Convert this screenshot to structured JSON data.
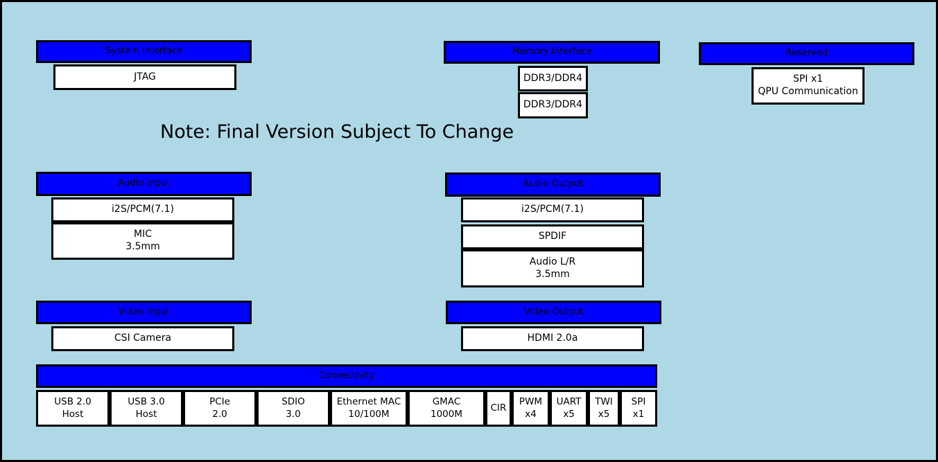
{
  "diagram": {
    "note": "Note: Final Version Subject To Change",
    "background_color": "#aed8e6",
    "header_color": "#0000ff",
    "cell_color": "#ffffff",
    "border_color": "#000000"
  },
  "groups": {
    "system_interface": {
      "title": "System Interface",
      "items": [
        {
          "line1": "JTAG",
          "line2": ""
        }
      ]
    },
    "memory_interface": {
      "title": "Memory Interface",
      "items": [
        {
          "line1": "DDR3/DDR4",
          "line2": ""
        },
        {
          "line1": "DDR3/DDR4",
          "line2": ""
        }
      ]
    },
    "reserved": {
      "title": "Reserved",
      "items": [
        {
          "line1": "SPI x1",
          "line2": "QPU Communication"
        }
      ]
    },
    "audio_input": {
      "title": "Audio Input",
      "items": [
        {
          "line1": "i2S/PCM(7.1)",
          "line2": ""
        },
        {
          "line1": "MIC",
          "line2": "3.5mm"
        }
      ]
    },
    "audio_output": {
      "title": "Audio Output",
      "items": [
        {
          "line1": "i2S/PCM(7.1)",
          "line2": ""
        },
        {
          "line1": "SPDIF",
          "line2": ""
        },
        {
          "line1": "Audio L/R",
          "line2": "3.5mm"
        }
      ]
    },
    "video_input": {
      "title": "Video Input",
      "items": [
        {
          "line1": "CSI Camera",
          "line2": ""
        }
      ]
    },
    "video_output": {
      "title": "Video Output",
      "items": [
        {
          "line1": "HDMI 2.0a",
          "line2": ""
        }
      ]
    },
    "connectivity": {
      "title": "Connectivity",
      "items": [
        {
          "line1": "USB 2.0",
          "line2": "Host"
        },
        {
          "line1": "USB 3.0",
          "line2": "Host"
        },
        {
          "line1": "PCIe",
          "line2": "2.0"
        },
        {
          "line1": "SDIO",
          "line2": "3.0"
        },
        {
          "line1": "Ethernet MAC",
          "line2": "10/100M"
        },
        {
          "line1": "GMAC",
          "line2": "1000M"
        },
        {
          "line1": "CIR",
          "line2": ""
        },
        {
          "line1": "PWM",
          "line2": "x4"
        },
        {
          "line1": "UART",
          "line2": "x5"
        },
        {
          "line1": "TWI",
          "line2": "x5"
        },
        {
          "line1": "SPI",
          "line2": "x1"
        }
      ]
    }
  }
}
